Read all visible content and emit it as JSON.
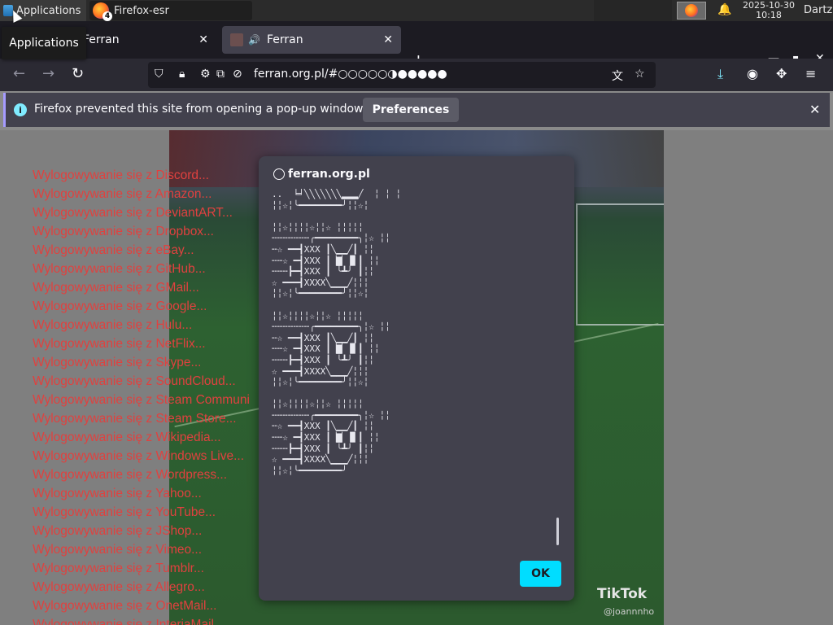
{
  "taskbar": {
    "apps_label": "Applications",
    "task_label": "Firefox-esr",
    "task_badge": "4",
    "clock_date": "2025-10-30",
    "clock_time": "10:18",
    "user": "Dartz"
  },
  "tooltip": "Applications",
  "tabs": [
    {
      "label": "Ferran",
      "active": false
    },
    {
      "label": "Ferran",
      "active": true
    }
  ],
  "navbar": {
    "url": "ferran.org.pl/#○○○○○◑●●●●●"
  },
  "notification": {
    "message": "Firefox prevented this site from opening a pop-up window.",
    "button": "Preferences"
  },
  "logout_items": [
    "Wylogowywanie się z Discord...",
    "Wylogowywanie się z Amazon...",
    "Wylogowywanie się z DeviantART...",
    "Wylogowywanie się z Dropbox...",
    "Wylogowywanie się z eBay...",
    "Wylogowywanie się z GitHub...",
    "Wylogowywanie się z GMail...",
    "Wylogowywanie się z Google...",
    "Wylogowywanie się z Hulu...",
    "Wylogowywanie się z NetFlix...",
    "Wylogowywanie się z Skype...",
    "Wylogowywanie się z SoundCloud...",
    "Wylogowywanie się z Steam Communi",
    "Wylogowywanie się z Steam Store...",
    "Wylogowywanie się z Wikipedia...",
    "Wylogowywanie się z Windows Live...",
    "Wylogowywanie się z Wordpress...",
    "Wylogowywanie się z Yahoo...",
    "Wylogowywanie się z YouTube...",
    "Wylogowywanie się z JShop...",
    "Wylogowywanie się z Vimeo...",
    "Wylogowywanie się z Tumblr...",
    "Wylogowywanie się z Allegro...",
    "Wylogowywanie się z OnetMail...",
    "Wylogowywanie się z InteriaMail..."
  ],
  "video": {
    "watermark": "TikTok",
    "username": "@joannnho"
  },
  "dialog": {
    "title": "ferran.org.pl",
    "ascii_art": "..  ╘╛╲╲╲╲╲╲╲▂▂▂╱  ╎ ╎ ╎\n╎╎☆╎╰━━━━━━━━╯╎╎☆╎\n\n╎╎☆╎╎╎╎☆╎╎☆ ╎╎╎╎╎\n╌╌╌╌╌╌╌╭━━━━━━━━╮╎☆ ╎╎\n╌☆ ━━┫XXX ┃╲▁▁╱┃ ╎╎\n╌╌☆ ━┫XXX ┃▕▇▏▐▌┃ ╎╎\n╌╌╌┣━┫XXX ┃ ╰┻╯ ┃╎╎\n☆ ━━━┫XXXX╲▁▁▁╱╎╎╎\n╎╎☆╎╰━━━━━━━━╯╎╎☆╎\n\n╎╎☆╎╎╎╎☆╎╎☆ ╎╎╎╎╎\n╌╌╌╌╌╌╌╭━━━━━━━━╮╎☆ ╎╎\n╌☆ ━━┫XXX ┃╲▁▁╱┃ ╎╎\n╌╌☆ ━┫XXX ┃▕▇▏▐▌┃ ╎╎\n╌╌╌┣━┫XXX ┃ ╰┻╯ ┃╎╎\n☆ ━━━┫XXXX╲▁▁▁╱╎╎╎\n╎╎☆╎╰━━━━━━━━╯╎╎☆╎\n\n╎╎☆╎╎╎╎☆╎╎☆ ╎╎╎╎╎\n╌╌╌╌╌╌╌╭━━━━━━━━╮╎☆ ╎╎\n╌☆ ━━┫XXX ┃╲▁▁╱┃ ╎╎\n╌╌☆ ━┫XXX ┃▕▇▏▐▌┃ ╎╎\n╌╌╌┣━┫XXX ┃ ╰┻╯ ┃╎╎\n☆ ━━━┫XXXX╲▁▁▁╱╎╎╎\n╎╎☆╎╰━━━━━━━━╯",
    "ok_label": "OK"
  }
}
